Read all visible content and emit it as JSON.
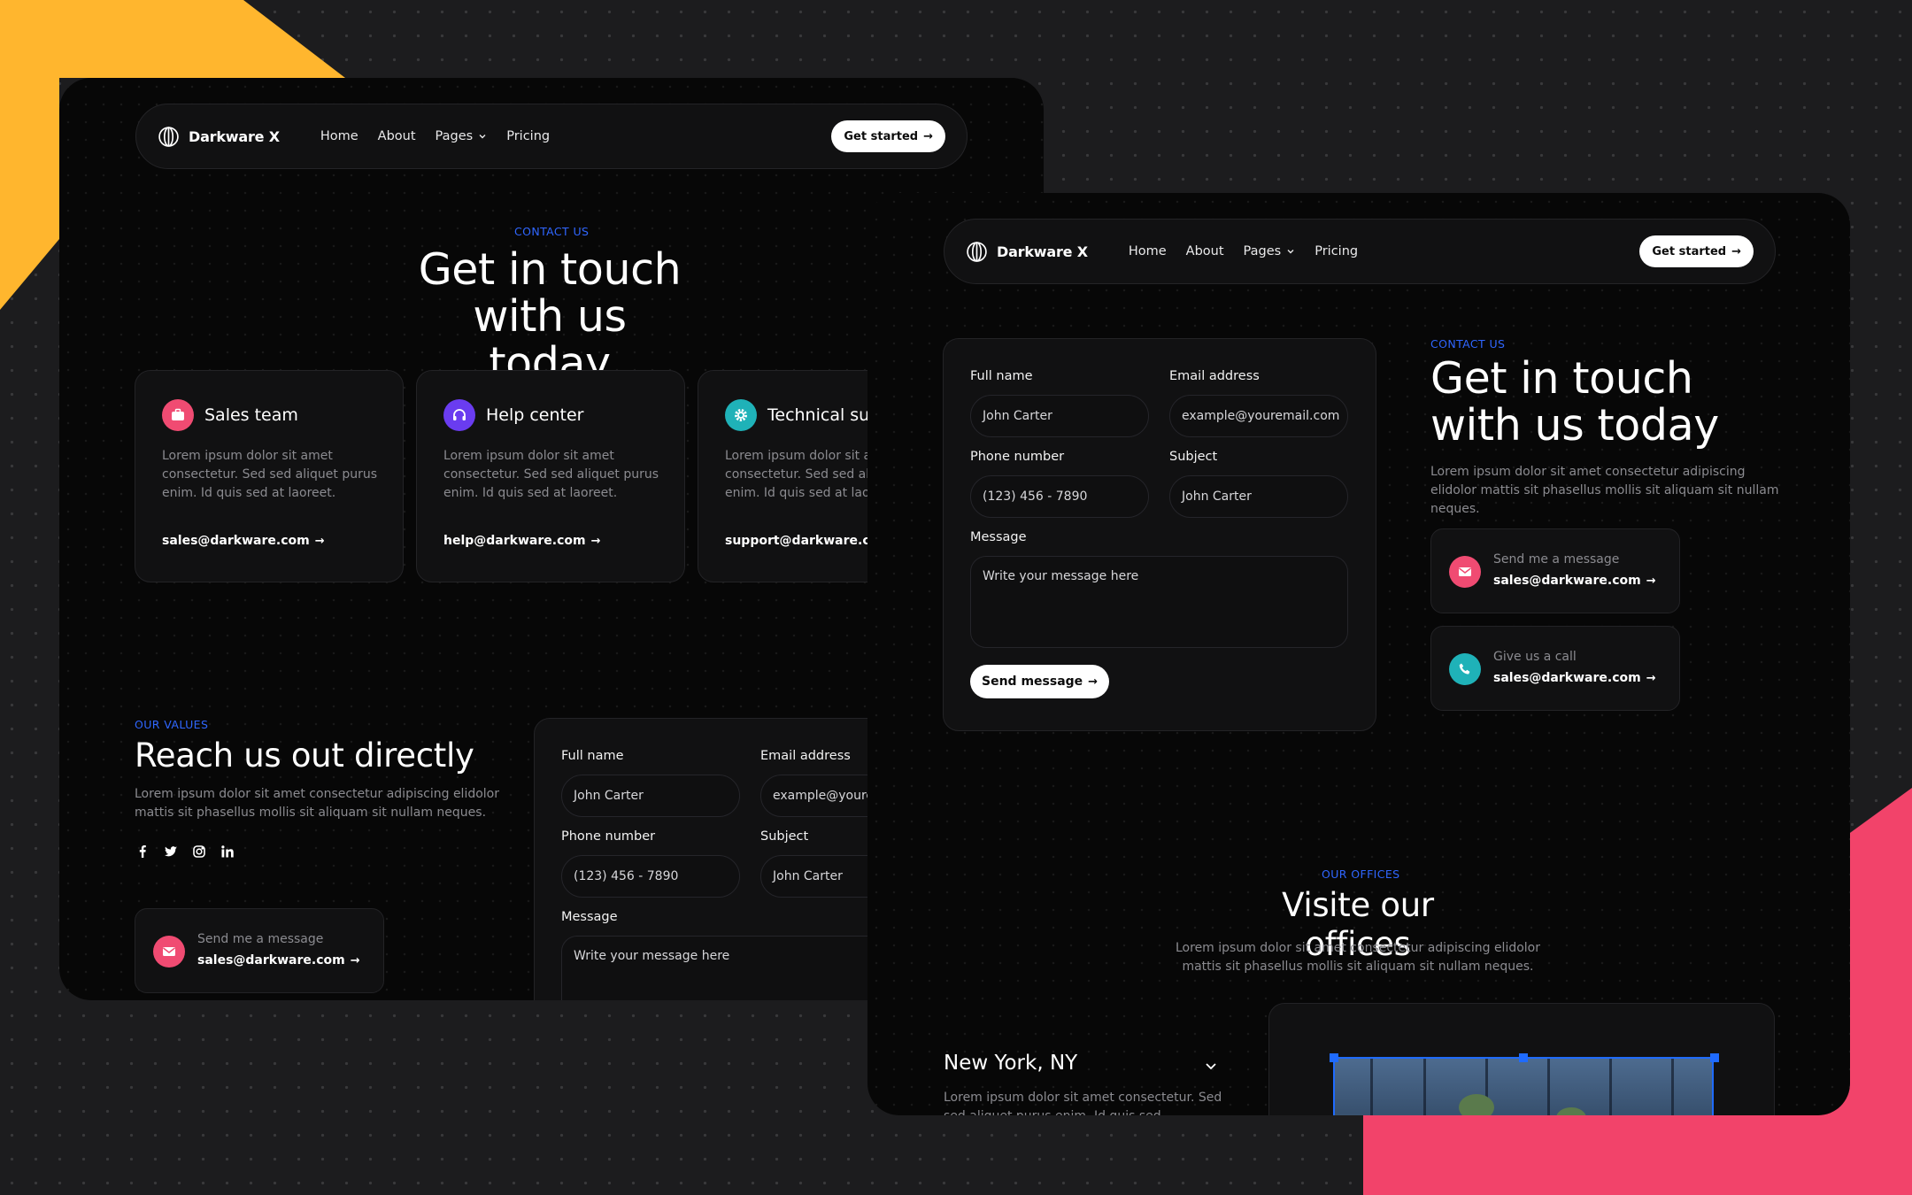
{
  "colors": {
    "background": "#1c1c1e",
    "window": "#070707",
    "accent_blue": "#2f66ff",
    "sun_yellow": "#ffb62e",
    "blob_pink": "#f2436a",
    "sales_pink": "#f04b72",
    "help_purple": "#6a3cf0",
    "tech_teal": "#1fb2b8"
  },
  "brand": {
    "name": "Darkware X",
    "logo_icon": "globe-icon"
  },
  "nav": {
    "links": [
      "Home",
      "About",
      "Pages",
      "Pricing"
    ],
    "cta": "Get started"
  },
  "left_page": {
    "hero": {
      "eyebrow": "CONTACT US",
      "title_line1": "Get in touch",
      "title_line2": "with us today"
    },
    "cards": [
      {
        "icon": "briefcase-icon",
        "title": "Sales team",
        "text": "Lorem ipsum dolor sit amet consectetur. Sed sed aliquet purus enim. Id quis sed at laoreet.",
        "link": "sales@darkware.com"
      },
      {
        "icon": "headset-icon",
        "title": "Help center",
        "text": "Lorem ipsum dolor sit amet consectetur. Sed sed aliquet purus enim. Id quis sed at laoreet.",
        "link": "help@darkware.com"
      },
      {
        "icon": "gear-icon",
        "title": "Technical support",
        "text": "Lorem ipsum dolor sit amet consectetur. Sed sed aliquet purus enim. Id quis sed at laoreet.",
        "link": "support@darkware.com"
      }
    ],
    "values": {
      "eyebrow": "OUR VALUES",
      "title": "Reach us out directly",
      "text": "Lorem ipsum dolor sit amet consectetur adipiscing elidolor mattis sit phasellus mollis sit aliquam sit nullam neques.",
      "social_icons": [
        "facebook-icon",
        "twitter-icon",
        "instagram-icon",
        "linkedin-icon"
      ]
    },
    "message_card": {
      "label": "Send me a message",
      "link": "sales@darkware.com"
    }
  },
  "form": {
    "full_name_label": "Full name",
    "full_name_value": "John Carter",
    "email_label": "Email address",
    "email_value": "example@youremail.com",
    "phone_label": "Phone number",
    "phone_value": "(123) 456 - 7890",
    "subject_label": "Subject",
    "subject_value": "John Carter",
    "message_label": "Message",
    "message_placeholder": "Write your message here",
    "submit": "Send message"
  },
  "right_page": {
    "hero": {
      "eyebrow": "CONTACT US",
      "title_line1": "Get in touch",
      "title_line2": "with us today",
      "text": "Lorem ipsum dolor sit amet consectetur adipiscing elidolor mattis sit phasellus mollis sit aliquam sit nullam neques."
    },
    "message_card": {
      "label": "Send me a message",
      "link": "sales@darkware.com"
    },
    "call_card": {
      "label": "Give us a call",
      "link": "sales@darkware.com"
    },
    "offices": {
      "eyebrow": "OUR OFFICES",
      "title": "Visite our offices",
      "text_line1": "Lorem ipsum dolor sit amet consectetur adipiscing elidolor",
      "text_line2": "mattis sit phasellus mollis sit aliquam sit nullam neques.",
      "first_office": "New York, NY",
      "first_office_text": "Lorem ipsum dolor sit amet consectetur. Sed sed aliquet purus enim. Id quis sed."
    }
  }
}
